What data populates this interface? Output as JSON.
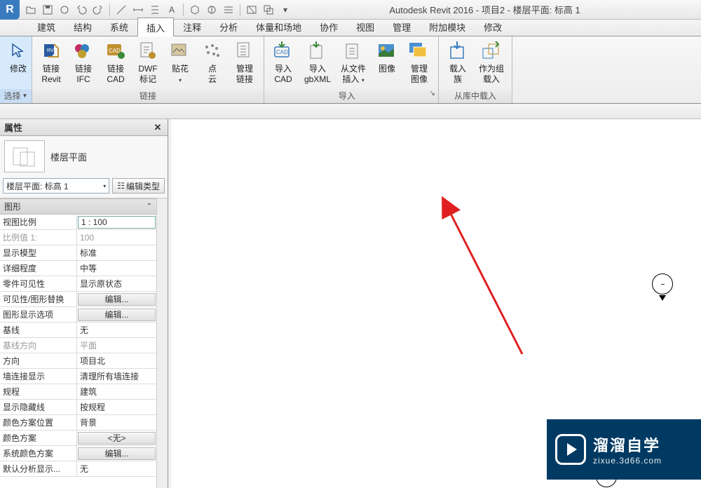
{
  "title": "Autodesk Revit 2016 -   项目2 - 楼层平面: 标高 1",
  "tabs": [
    "建筑",
    "结构",
    "系统",
    "插入",
    "注释",
    "分析",
    "体量和场地",
    "协作",
    "视图",
    "管理",
    "附加模块",
    "修改"
  ],
  "active_tab_index": 3,
  "ribbon": {
    "select": {
      "label": "修改",
      "group_title": "选择"
    },
    "link_group": {
      "title": "链接",
      "items": [
        {
          "l1": "链接",
          "l2": "Revit"
        },
        {
          "l1": "链接",
          "l2": "IFC"
        },
        {
          "l1": "链接",
          "l2": "CAD"
        },
        {
          "l1": "DWF",
          "l2": "标记"
        },
        {
          "l1": "贴花",
          "l2": ""
        },
        {
          "l1": "点",
          "l2": "云"
        },
        {
          "l1": "管理",
          "l2": "链接"
        }
      ]
    },
    "import_group": {
      "title": "导入",
      "items": [
        {
          "l1": "导入",
          "l2": "CAD"
        },
        {
          "l1": "导入",
          "l2": "gbXML"
        },
        {
          "l1": "从文件",
          "l2": "插入"
        },
        {
          "l1": "图像",
          "l2": ""
        },
        {
          "l1": "管理",
          "l2": "图像"
        }
      ]
    },
    "loadlib_group": {
      "title": "从库中载入",
      "items": [
        {
          "l1": "载入",
          "l2": "族"
        },
        {
          "l1": "作为组",
          "l2": "载入"
        }
      ]
    }
  },
  "properties": {
    "panel_title": "属性",
    "type_name": "楼层平面",
    "instance_name": "楼层平面: 标高 1",
    "edit_type": "编辑类型",
    "section_title": "图形",
    "rows": [
      {
        "label": "视图比例",
        "value": "1 : 100",
        "mode": "input"
      },
      {
        "label": "比例值 1:",
        "value": "100",
        "mode": "disabled"
      },
      {
        "label": "显示模型",
        "value": "标准",
        "mode": "text"
      },
      {
        "label": "详细程度",
        "value": "中等",
        "mode": "text"
      },
      {
        "label": "零件可见性",
        "value": "显示原状态",
        "mode": "text"
      },
      {
        "label": "可见性/图形替换",
        "value": "编辑...",
        "mode": "button"
      },
      {
        "label": "图形显示选项",
        "value": "编辑...",
        "mode": "button"
      },
      {
        "label": "基线",
        "value": "无",
        "mode": "text"
      },
      {
        "label": "基线方向",
        "value": "平面",
        "mode": "disabled"
      },
      {
        "label": "方向",
        "value": "项目北",
        "mode": "text"
      },
      {
        "label": "墙连接显示",
        "value": "清理所有墙连接",
        "mode": "text"
      },
      {
        "label": "规程",
        "value": "建筑",
        "mode": "text"
      },
      {
        "label": "显示隐藏线",
        "value": "按规程",
        "mode": "text"
      },
      {
        "label": "颜色方案位置",
        "value": "背景",
        "mode": "text"
      },
      {
        "label": "颜色方案",
        "value": "<无>",
        "mode": "button"
      },
      {
        "label": "系统颜色方案",
        "value": "编辑...",
        "mode": "button"
      },
      {
        "label": "默认分析显示...",
        "value": "无",
        "mode": "text"
      }
    ]
  },
  "watermark": {
    "cn": "溜溜自学",
    "url": "zixue.3d66.com"
  }
}
